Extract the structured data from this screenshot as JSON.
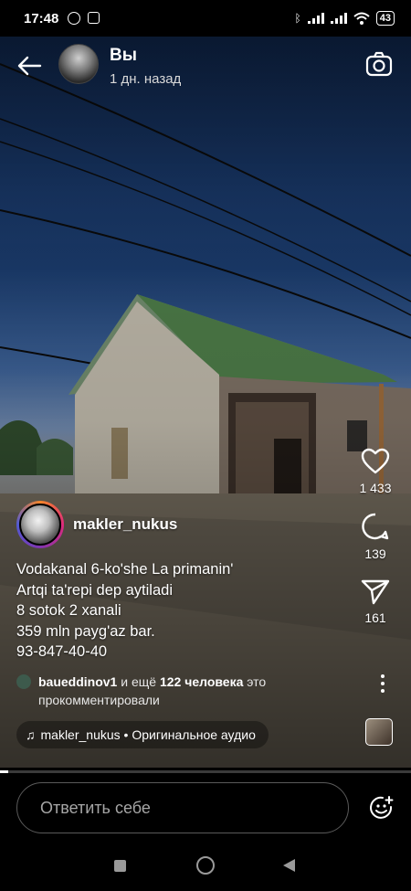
{
  "status_bar": {
    "time": "17:48",
    "battery": "43"
  },
  "header": {
    "name": "Вы",
    "time_ago": "1 дн. назад"
  },
  "author": {
    "handle": "makler_nukus"
  },
  "caption_lines": [
    "Vodakanal 6-ko'she La primanin'",
    "Artqi ta'repi dep aytiladi",
    "8 sotok 2 xanali",
    "359 mln payg'az bar.",
    "93-847-40-40"
  ],
  "actions": {
    "likes": "1 433",
    "comments": "139",
    "shares": "161"
  },
  "comments_line": {
    "user": "baueddinov1",
    "middle": " и ещё ",
    "others": "122 человека",
    "tail": " это",
    "line2": "прокомментировали"
  },
  "audio": {
    "label": "makler_nukus • Оригинальное аудио"
  },
  "progress": 0.02,
  "reply": {
    "placeholder": "Ответить себе"
  }
}
